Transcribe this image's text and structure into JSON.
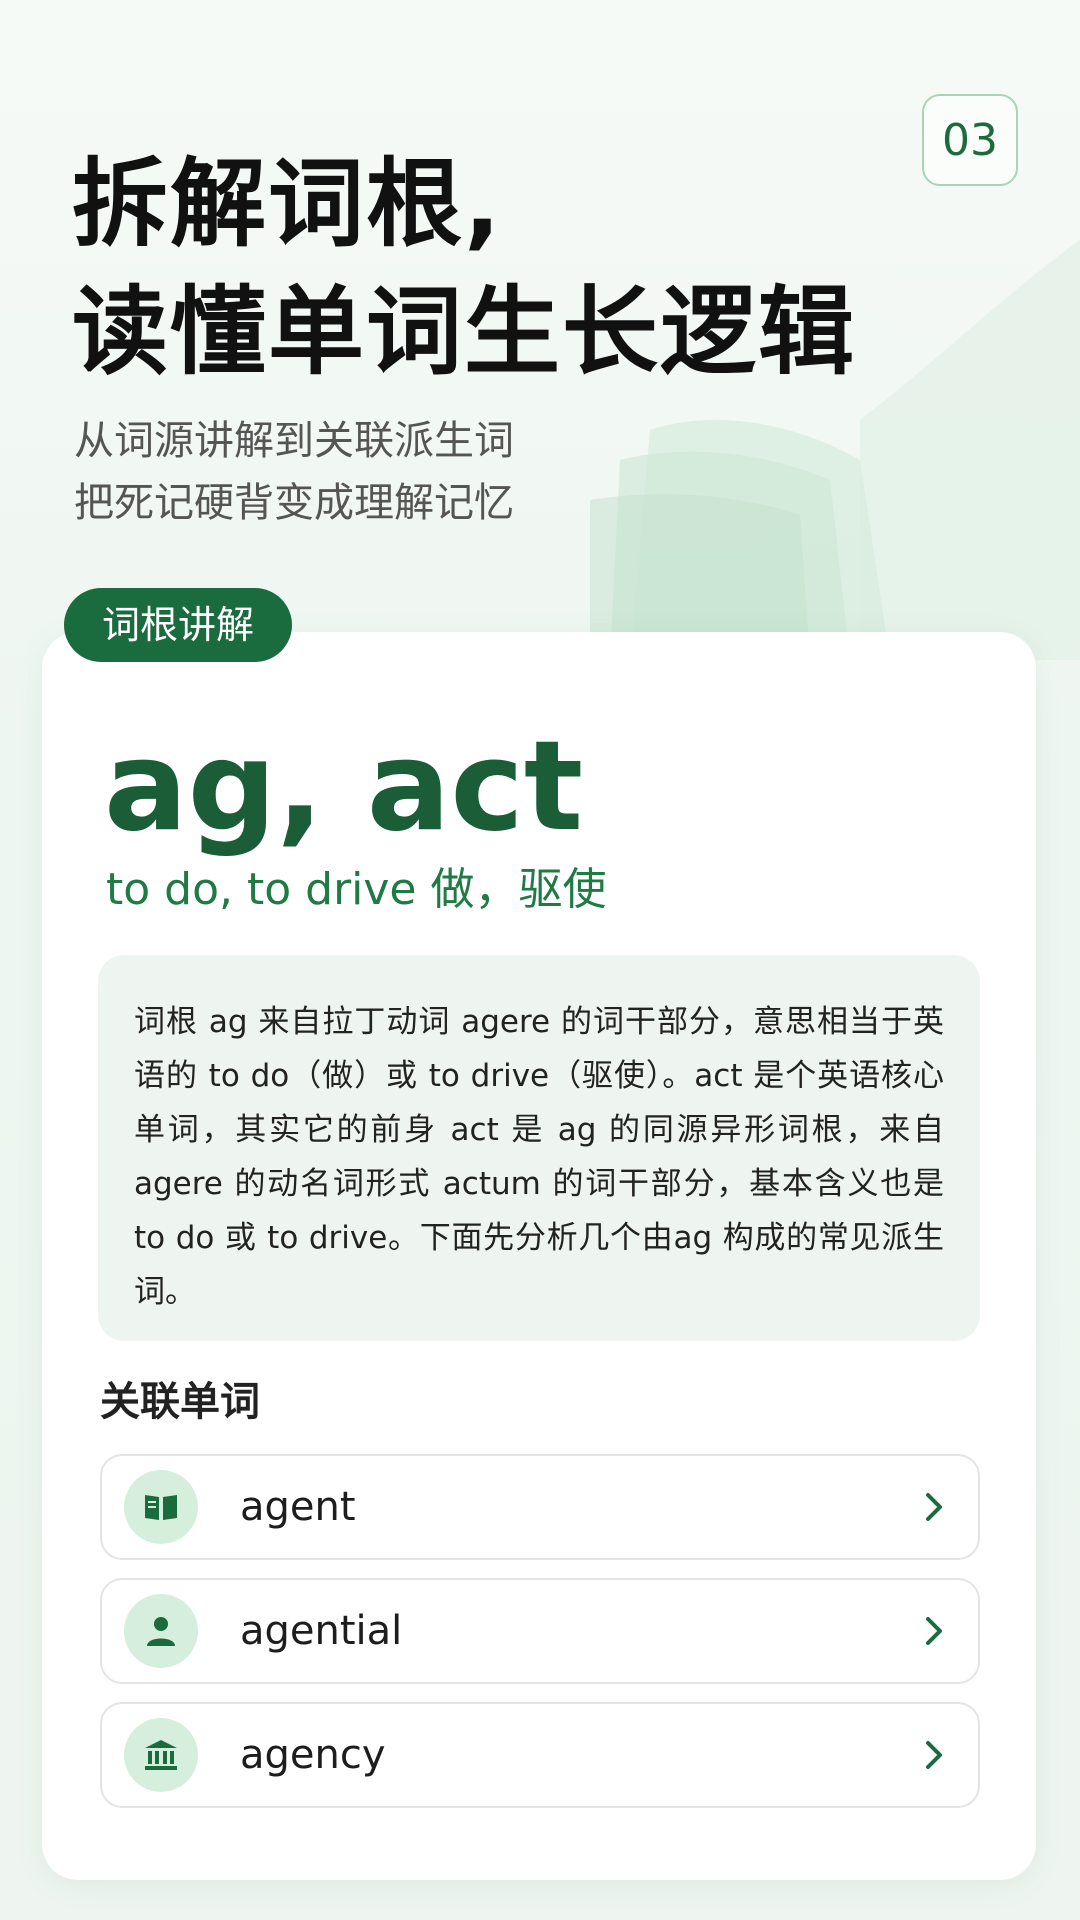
{
  "page_number": "03",
  "headline": {
    "line1": "拆解词根,",
    "line2": "读懂单词生长逻辑"
  },
  "subtitle": {
    "line1": "从词源讲解到关联派生词",
    "line2": "把死记硬背变成理解记忆"
  },
  "section_tag": "词根讲解",
  "root": {
    "word": "ag, act",
    "meaning": "to do, to drive 做，驱使"
  },
  "explanation": "词根 ag 来自拉丁动词 agere 的词干部分，意思相当于英语的 to do（做）或 to drive（驱使）。act 是个英语核心单词，其实它的前身 act 是 ag 的同源异形词根，来自 agere 的动名词形式 actum 的词干部分，基本含义也是 to do 或 to drive。下面先分析几个由ag 构成的常见派生词。",
  "related": {
    "title": "关联单词",
    "items": [
      {
        "word": "agent",
        "icon": "book-icon"
      },
      {
        "word": "agential",
        "icon": "person-icon"
      },
      {
        "word": "agency",
        "icon": "building-icon"
      }
    ]
  },
  "colors": {
    "accent": "#1a6b3d",
    "accent_light": "#d6efdd",
    "explain_bg": "#eef5f0"
  }
}
